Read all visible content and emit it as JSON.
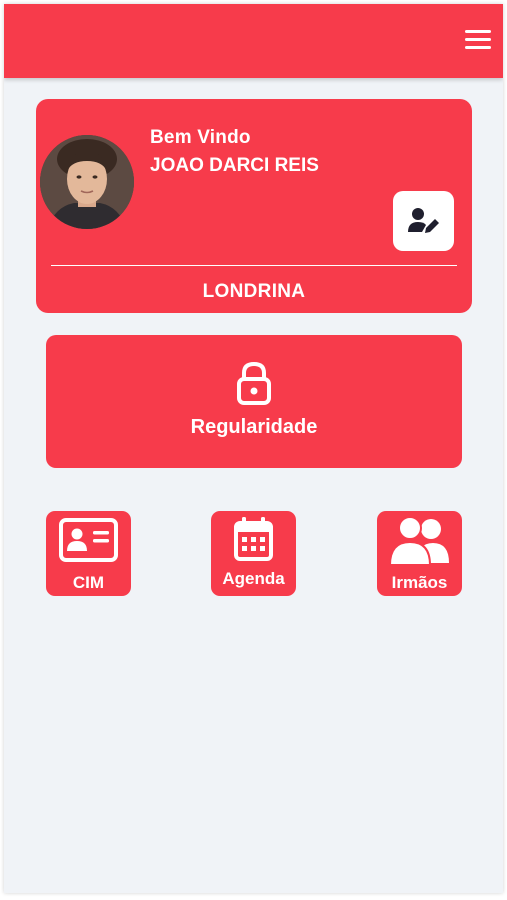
{
  "header": {
    "menu_icon": "hamburger-menu-icon"
  },
  "profile": {
    "greeting": "Bem Vindo",
    "name": "JOAO DARCI REIS",
    "city": "LONDRINA",
    "edit_icon": "user-edit-icon"
  },
  "regularidade": {
    "label": "Regularidade",
    "icon": "lock-icon"
  },
  "tiles": [
    {
      "label": "CIM",
      "icon": "id-card-icon"
    },
    {
      "label": "Agenda",
      "icon": "calendar-icon"
    },
    {
      "label": "Irmãos",
      "icon": "users-icon"
    }
  ],
  "colors": {
    "accent": "#f73b4b",
    "background": "#f0f3f7",
    "icon_dark": "#1f1f2e"
  }
}
